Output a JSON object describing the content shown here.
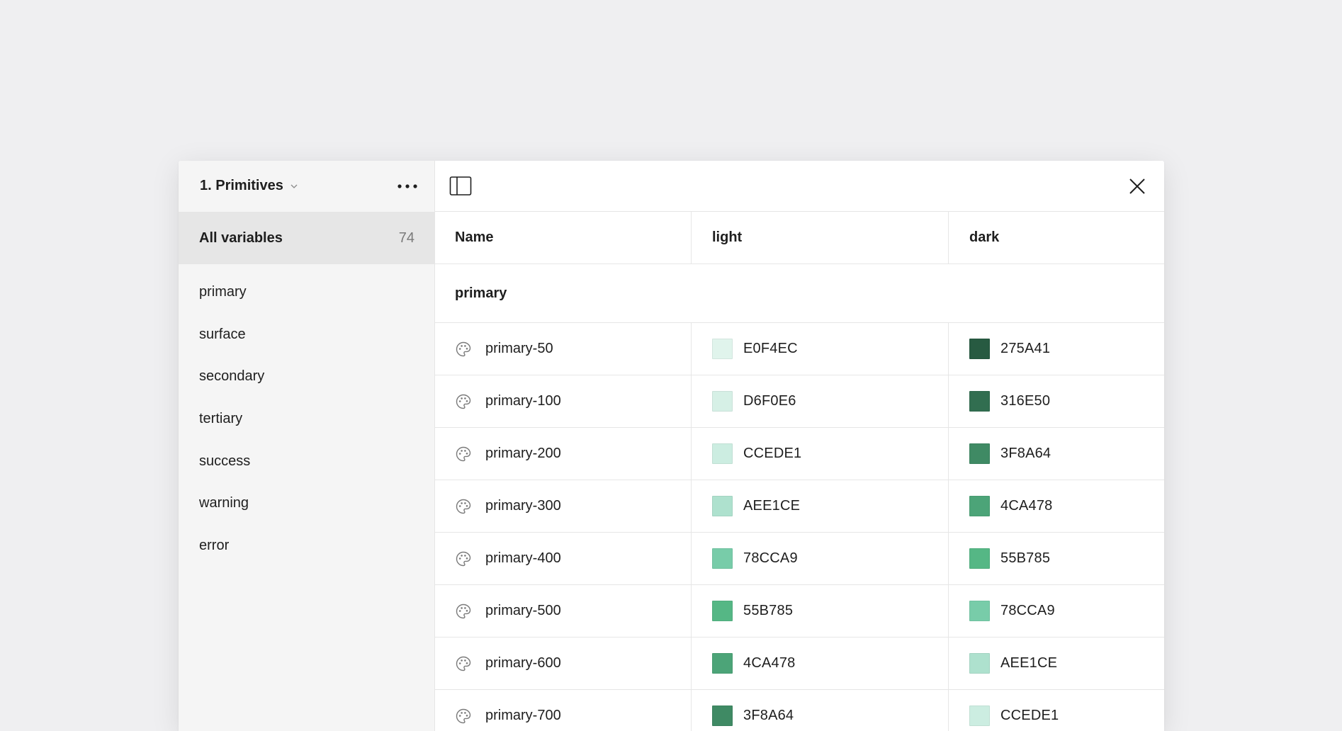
{
  "sidebar": {
    "collection_title": "1. Primitives",
    "all_variables_label": "All variables",
    "all_variables_count": "74",
    "groups": [
      "primary",
      "surface",
      "secondary",
      "tertiary",
      "success",
      "warning",
      "error"
    ]
  },
  "table": {
    "headers": {
      "name": "Name",
      "light": "light",
      "dark": "dark"
    },
    "group_title": "primary",
    "rows": [
      {
        "name": "primary-50",
        "light": "E0F4EC",
        "dark": "275A41",
        "light_color": "#E0F4EC",
        "dark_color": "#275A41"
      },
      {
        "name": "primary-100",
        "light": "D6F0E6",
        "dark": "316E50",
        "light_color": "#D6F0E6",
        "dark_color": "#316E50"
      },
      {
        "name": "primary-200",
        "light": "CCEDE1",
        "dark": "3F8A64",
        "light_color": "#CCEDE1",
        "dark_color": "#3F8A64"
      },
      {
        "name": "primary-300",
        "light": "AEE1CE",
        "dark": "4CA478",
        "light_color": "#AEE1CE",
        "dark_color": "#4CA478"
      },
      {
        "name": "primary-400",
        "light": "78CCA9",
        "dark": "55B785",
        "light_color": "#78CCA9",
        "dark_color": "#55B785"
      },
      {
        "name": "primary-500",
        "light": "55B785",
        "dark": "78CCA9",
        "light_color": "#55B785",
        "dark_color": "#78CCA9"
      },
      {
        "name": "primary-600",
        "light": "4CA478",
        "dark": "AEE1CE",
        "light_color": "#4CA478",
        "dark_color": "#AEE1CE"
      },
      {
        "name": "primary-700",
        "light": "3F8A64",
        "dark": "CCEDE1",
        "light_color": "#3F8A64",
        "dark_color": "#CCEDE1"
      }
    ]
  },
  "icons": {
    "collection_dropdown": "chevron-down-icon",
    "more": "more-horizontal-icon",
    "toggle_sidebar": "sidebar-toggle-icon",
    "close": "close-icon",
    "variable_type": "color-palette-icon"
  },
  "colors": {
    "background": "#EFEFF1",
    "sidebar_bg": "#F5F5F5",
    "selected_bg": "#E6E6E6",
    "divider": "#E6E6E6"
  }
}
